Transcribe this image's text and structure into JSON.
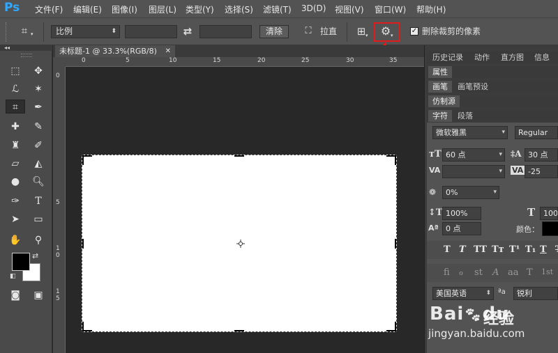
{
  "app": {
    "logo": "Ps"
  },
  "menu": [
    "文件(F)",
    "编辑(E)",
    "图像(I)",
    "图层(L)",
    "类型(Y)",
    "选择(S)",
    "滤镜(T)",
    "3D(D)",
    "视图(V)",
    "窗口(W)",
    "帮助(H)"
  ],
  "options": {
    "ratio_label": "比例",
    "clear_label": "清除",
    "straighten_label": "拉直",
    "delete_cropped_label": "删除裁剪的像素",
    "delete_cropped_checked": true,
    "swap_icon": "⇄",
    "settings_icon": "gear-icon"
  },
  "document": {
    "tab_title": "未标题-1 @ 33.3%(RGB/8)",
    "close_glyph": "✕",
    "ruler_top": [
      "0",
      "5",
      "10",
      "15",
      "20",
      "25",
      "30",
      "35"
    ],
    "ruler_left": [
      "0",
      "5",
      "1",
      "0",
      "1",
      "5"
    ]
  },
  "panels": {
    "row1": [
      "历史记录",
      "动作",
      "直方图",
      "信息"
    ],
    "row2": [
      "属性"
    ],
    "row3": [
      "画笔",
      "画笔预设"
    ],
    "row4": [
      "仿制源"
    ],
    "row5": [
      "字符",
      "段落"
    ]
  },
  "character": {
    "font_family": "微软雅黑",
    "font_style": "Regular",
    "font_size": "60 点",
    "leading": "30 点",
    "kerning": "",
    "tracking": "-25",
    "tsume": "0%",
    "vertical_scale": "100%",
    "horizontal_scale": "100%",
    "baseline_shift": "0 点",
    "color_label": "颜色：",
    "style_glyphs": [
      "T",
      "T",
      "TT",
      "Tт",
      "T¹",
      "T₁",
      "T",
      "T"
    ],
    "opentype_glyphs": [
      "ﬁ",
      "ℴ",
      "st",
      "A",
      "aa",
      "T",
      "1st"
    ],
    "language": "美国英语",
    "aa_label": "ªa",
    "antialias": "锐利"
  },
  "watermark": {
    "brand": "Bai",
    "brand2": "du",
    "jingyan": "经验",
    "url": "jingyan.baidu.com"
  },
  "colors": {
    "accent": "#31a8ff",
    "highlight": "#e01b1b"
  }
}
